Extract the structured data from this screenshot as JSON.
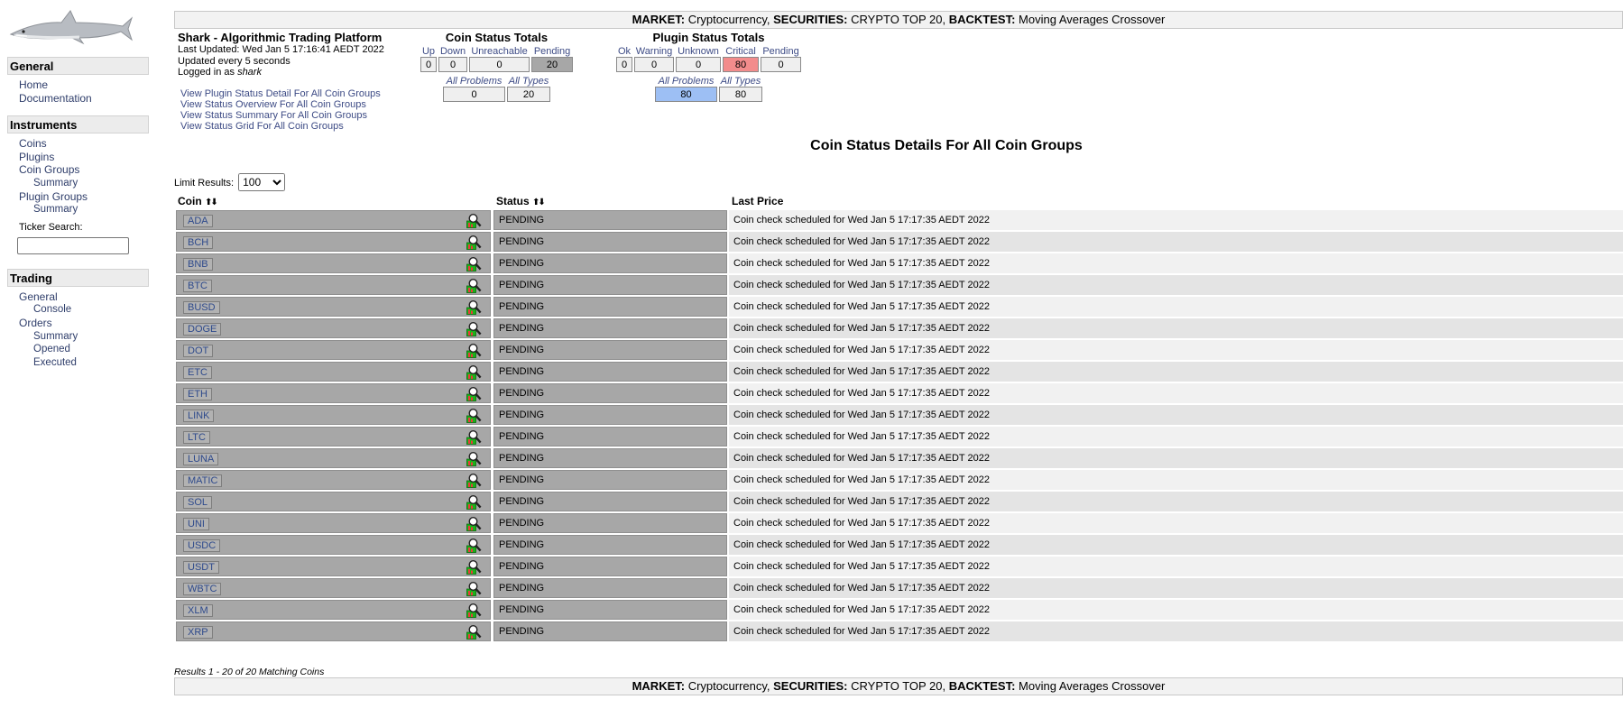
{
  "banner": {
    "market_label": "MARKET:",
    "market_value": "Cryptocurrency,",
    "securities_label": "SECURITIES:",
    "securities_value": "CRYPTO TOP 20,",
    "backtest_label": "BACKTEST:",
    "backtest_value": "Moving Averages Crossover"
  },
  "sidebar": {
    "general": {
      "title": "General",
      "items": [
        {
          "label": "Home"
        },
        {
          "label": "Documentation"
        }
      ]
    },
    "instruments": {
      "title": "Instruments",
      "items": [
        {
          "label": "Coins"
        },
        {
          "label": "Plugins"
        },
        {
          "label": "Coin Groups"
        },
        {
          "label": "Summary"
        },
        {
          "label": "Plugin Groups"
        },
        {
          "label": "Summary"
        }
      ],
      "ticker_search_label": "Ticker Search:",
      "ticker_search_value": ""
    },
    "trading": {
      "title": "Trading",
      "items": [
        {
          "label": "General"
        },
        {
          "label": "Console"
        },
        {
          "label": "Orders"
        },
        {
          "label": "Summary"
        },
        {
          "label": "Opened"
        },
        {
          "label": "Executed"
        }
      ]
    }
  },
  "info": {
    "title": "Shark - Algorithmic Trading Platform",
    "last_updated": "Last Updated: Wed Jan 5 17:16:41 AEDT 2022",
    "refresh": "Updated every 5 seconds",
    "logged_in_prefix": "Logged in as",
    "user": "shark",
    "links": [
      "View Plugin Status Detail For All Coin Groups",
      "View Status Overview For All Coin Groups",
      "View Status Summary For All Coin Groups",
      "View Status Grid For All Coin Groups"
    ]
  },
  "coin_totals": {
    "title": "Coin Status Totals",
    "headers": [
      "Up",
      "Down",
      "Unreachable",
      "Pending"
    ],
    "values": [
      "0",
      "0",
      "0",
      "20"
    ],
    "sum_headers": [
      "All Problems",
      "All Types"
    ],
    "sum_values": [
      "0",
      "20"
    ]
  },
  "plugin_totals": {
    "title": "Plugin Status Totals",
    "headers": [
      "Ok",
      "Warning",
      "Unknown",
      "Critical",
      "Pending"
    ],
    "values": [
      "0",
      "0",
      "0",
      "80",
      "0"
    ],
    "sum_headers": [
      "All Problems",
      "All Types"
    ],
    "sum_values": [
      "80",
      "80"
    ]
  },
  "page_heading": "Coin Status Details For All Coin Groups",
  "limit": {
    "label": "Limit Results:",
    "selected": "100"
  },
  "table": {
    "columns": [
      "Coin",
      "Status",
      "Last Price"
    ],
    "sort_glyphs": "⬆⬇",
    "rows": [
      {
        "coin": "ADA",
        "status": "PENDING",
        "last_price": "Coin check scheduled for Wed Jan 5 17:17:35 AEDT 2022"
      },
      {
        "coin": "BCH",
        "status": "PENDING",
        "last_price": "Coin check scheduled for Wed Jan 5 17:17:35 AEDT 2022"
      },
      {
        "coin": "BNB",
        "status": "PENDING",
        "last_price": "Coin check scheduled for Wed Jan 5 17:17:35 AEDT 2022"
      },
      {
        "coin": "BTC",
        "status": "PENDING",
        "last_price": "Coin check scheduled for Wed Jan 5 17:17:35 AEDT 2022"
      },
      {
        "coin": "BUSD",
        "status": "PENDING",
        "last_price": "Coin check scheduled for Wed Jan 5 17:17:35 AEDT 2022"
      },
      {
        "coin": "DOGE",
        "status": "PENDING",
        "last_price": "Coin check scheduled for Wed Jan 5 17:17:35 AEDT 2022"
      },
      {
        "coin": "DOT",
        "status": "PENDING",
        "last_price": "Coin check scheduled for Wed Jan 5 17:17:35 AEDT 2022"
      },
      {
        "coin": "ETC",
        "status": "PENDING",
        "last_price": "Coin check scheduled for Wed Jan 5 17:17:35 AEDT 2022"
      },
      {
        "coin": "ETH",
        "status": "PENDING",
        "last_price": "Coin check scheduled for Wed Jan 5 17:17:35 AEDT 2022"
      },
      {
        "coin": "LINK",
        "status": "PENDING",
        "last_price": "Coin check scheduled for Wed Jan 5 17:17:35 AEDT 2022"
      },
      {
        "coin": "LTC",
        "status": "PENDING",
        "last_price": "Coin check scheduled for Wed Jan 5 17:17:35 AEDT 2022"
      },
      {
        "coin": "LUNA",
        "status": "PENDING",
        "last_price": "Coin check scheduled for Wed Jan 5 17:17:35 AEDT 2022"
      },
      {
        "coin": "MATIC",
        "status": "PENDING",
        "last_price": "Coin check scheduled for Wed Jan 5 17:17:35 AEDT 2022"
      },
      {
        "coin": "SOL",
        "status": "PENDING",
        "last_price": "Coin check scheduled for Wed Jan 5 17:17:35 AEDT 2022"
      },
      {
        "coin": "UNI",
        "status": "PENDING",
        "last_price": "Coin check scheduled for Wed Jan 5 17:17:35 AEDT 2022"
      },
      {
        "coin": "USDC",
        "status": "PENDING",
        "last_price": "Coin check scheduled for Wed Jan 5 17:17:35 AEDT 2022"
      },
      {
        "coin": "USDT",
        "status": "PENDING",
        "last_price": "Coin check scheduled for Wed Jan 5 17:17:35 AEDT 2022"
      },
      {
        "coin": "WBTC",
        "status": "PENDING",
        "last_price": "Coin check scheduled for Wed Jan 5 17:17:35 AEDT 2022"
      },
      {
        "coin": "XLM",
        "status": "PENDING",
        "last_price": "Coin check scheduled for Wed Jan 5 17:17:35 AEDT 2022"
      },
      {
        "coin": "XRP",
        "status": "PENDING",
        "last_price": "Coin check scheduled for Wed Jan 5 17:17:35 AEDT 2022"
      }
    ]
  },
  "results_text": "Results 1 - 20 of 20 Matching Coins",
  "icons": {
    "logo": "shark-logo",
    "coin_detail": "magnifier-chart-icon",
    "sort": "sort-arrows-icon"
  },
  "colors": {
    "pending": "#a7a7a7",
    "critical": "#f28c8c",
    "problems": "#9dbff4",
    "link": "#2e3d6a"
  }
}
